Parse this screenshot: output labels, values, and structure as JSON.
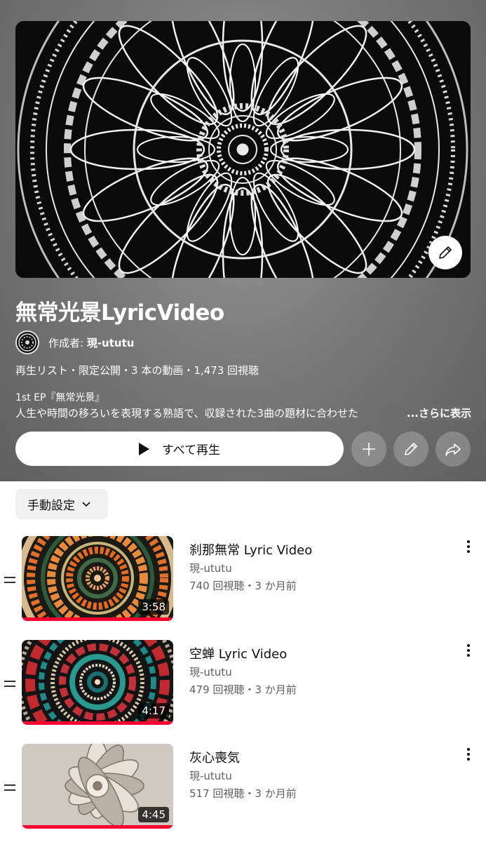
{
  "playlist": {
    "title": "無常光景LyricVideo",
    "owner_prefix": "作成者: ",
    "owner_name": "現-ututu",
    "meta": "再生リスト・限定公開・3 本の動画・1,473 回視聴",
    "description_line1": "1st EP『無常光景』",
    "description_line2": "人生や時間の移ろいを表現する熟語で、収録された3曲の題材に合わせた",
    "more_label": "...さらに表示",
    "icons": {
      "cover_edit": "pencil-icon",
      "add": "plus-icon",
      "edit": "pencil-icon",
      "share": "share-icon"
    }
  },
  "actions": {
    "play_all_label": "すべて再生"
  },
  "sort": {
    "selected": "手動設定",
    "icon": "chevron-down-icon"
  },
  "videos": [
    {
      "title": "刹那無常 Lyric Video",
      "channel": "現-ututu",
      "meta": "740 回視聴・3 か月前",
      "duration": "3:58"
    },
    {
      "title": "空蝉  Lyric Video",
      "channel": "現-ututu",
      "meta": "479 回視聴・3 か月前",
      "duration": "4:17"
    },
    {
      "title": "灰心喪気",
      "channel": "現-ututu",
      "meta": "517 回視聴・3 か月前",
      "duration": "4:45"
    }
  ],
  "colors": {
    "header_bg": "#7a7a7a",
    "progress": "#ff0033",
    "secondary_text": "#606060"
  }
}
